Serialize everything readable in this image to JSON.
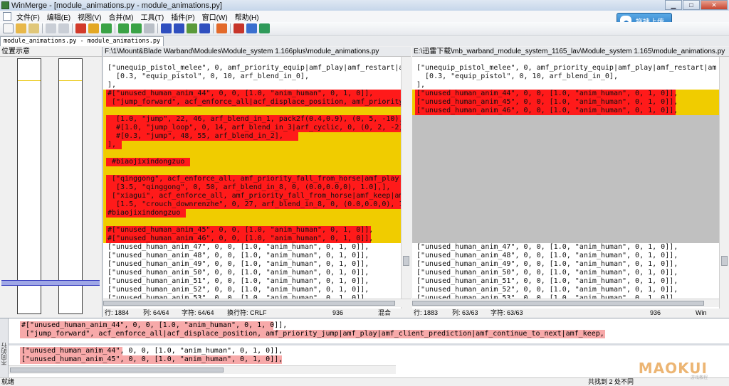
{
  "window": {
    "title": "WinMerge - [module_animations.py - module_animations.py]"
  },
  "menu": [
    "文件(F)",
    "编辑(E)",
    "视图(V)",
    "合并(M)",
    "工具(T)",
    "插件(P)",
    "窗口(W)",
    "帮助(H)"
  ],
  "upload_button": {
    "label": "拖拽上传"
  },
  "tab": {
    "label": "module_animations.py - module_animations.py"
  },
  "location_pane": {
    "header": "位置示意"
  },
  "left": {
    "path": "F:\\1\\Mount&Blade Warband\\Modules\\Module_system 1.166plus\\module_animations.py",
    "lines": [
      {
        "text": "[\"unequip_pistol_melee\", 0, amf_priority_equip|amf_play|amf_restart|am",
        "style": "plain"
      },
      {
        "text": "  [0.3, \"equip_pistol\", 0, 10, arf_blend_in_0],",
        "style": "plain"
      },
      {
        "text": "],",
        "style": "plain"
      },
      {
        "text": "#[\"unused_human_anim_44\", 0, 0, [1.0, \"anim_human\", 0, 1, 0]],",
        "style": "diff",
        "red": true,
        "red_width": 426
      },
      {
        "text": " [\"jump_forward\", acf_enforce_all|acf_displace_position, amf_priority_",
        "style": "diff",
        "red": true,
        "red_width": 426
      },
      {
        "text": "",
        "style": "diff"
      },
      {
        "text": "  [1.0, \"jump\", 22, 46, arf_blend_in_1, pack2f(0.4,0.9), (0, 5, -10),",
        "style": "diff",
        "red": true,
        "red_width": 426
      },
      {
        "text": "  #[1.0, \"jump_loop\", 0, 14, arf_blend_in_3|arf_cyclic, 0, (0, 2, -2),",
        "style": "diff",
        "red": true,
        "red_width": 426
      },
      {
        "text": "  #[0.3, \"jump\", 48, 55, arf_blend_in_2],",
        "style": "diff",
        "red": true,
        "red_width": 270
      },
      {
        "text": "],",
        "style": "diff",
        "red": true,
        "red_width": 22
      },
      {
        "text": "",
        "style": "diff"
      },
      {
        "text": " #biaojixindongzuo",
        "style": "diff",
        "red": true,
        "red_width": 118
      },
      {
        "text": "",
        "style": "diff"
      },
      {
        "text": " [\"qinggong\", acf_enforce_all, amf_priority_fall_from_horse|amf_play|a",
        "style": "diff",
        "red": true,
        "red_width": 426
      },
      {
        "text": "  [3.5, \"qinggong\", 0, 50, arf_blend_in_8, 0, (0.0,0.0,0), 1.0],],",
        "style": "diff",
        "red": true,
        "red_width": 426
      },
      {
        "text": " [\"xiagui\", acf_enforce_all, amf_priority_fall_from_horse|amf_keep|am",
        "style": "diff",
        "red": true,
        "red_width": 426
      },
      {
        "text": "  [1.5, \"crouch_downrenzhe\", 0, 27, arf_blend_in_8, 0, (0.0,0.0,0), 1",
        "style": "diff",
        "red": true,
        "red_width": 426
      },
      {
        "text": "#biaojixindongzuo",
        "style": "diff",
        "red": true,
        "red_width": 112
      },
      {
        "text": "",
        "style": "diff"
      },
      {
        "text": "#[\"unused_human_anim_45\", 0, 0, [1.0, \"anim_human\", 0, 1, 0]],",
        "style": "diff",
        "red": true,
        "red_width": 372
      },
      {
        "text": "#[\"unused_human_anim_46\", 0, 0, [1.0, \"anim_human\", 0, 1, 0]],",
        "style": "diff",
        "red": true,
        "red_width": 372
      },
      {
        "text": "[\"unused_human_anim_47\", 0, 0, [1.0, \"anim_human\", 0, 1, 0]],",
        "style": "plain"
      },
      {
        "text": "[\"unused_human_anim_48\", 0, 0, [1.0, \"anim_human\", 0, 1, 0]],",
        "style": "plain"
      },
      {
        "text": "[\"unused_human_anim_49\", 0, 0, [1.0, \"anim_human\", 0, 1, 0]],",
        "style": "plain"
      },
      {
        "text": "[\"unused_human_anim_50\", 0, 0, [1.0, \"anim_human\", 0, 1, 0]],",
        "style": "plain"
      },
      {
        "text": "[\"unused_human_anim_51\", 0, 0, [1.0, \"anim_human\", 0, 1, 0]],",
        "style": "plain"
      },
      {
        "text": "[\"unused_human_anim_52\", 0, 0, [1.0, \"anim_human\", 0, 1, 0]],",
        "style": "plain"
      },
      {
        "text": "[\"unused_human_anim_53\", 0, 0, [1.0, \"anim_human\", 0, 1, 0]],",
        "style": "plain"
      }
    ],
    "status": {
      "row": "行: 1884",
      "col": "列: 64/64",
      "chars": "字符: 64/64",
      "eol": "换行符: CRLF",
      "codepage": "936",
      "mode": "混合"
    }
  },
  "right": {
    "path": "E:\\迅雷下载\\mb_warband_module_system_1165_lav\\Module_system 1.165\\module_animations.py",
    "lines": [
      {
        "text": "[\"unequip_pistol_melee\", 0, amf_priority_equip|amf_play|amf_restart|am",
        "style": "plain"
      },
      {
        "text": "  [0.3, \"equip_pistol\", 0, 10, arf_blend_in_0],",
        "style": "plain"
      },
      {
        "text": "],",
        "style": "plain"
      },
      {
        "text": "[\"unused_human_anim_44\", 0, 0, [1.0, \"anim_human\", 0, 1, 0]],",
        "style": "diff",
        "red": true,
        "red_width": 366
      },
      {
        "text": "[\"unused_human_anim_45\", 0, 0, [1.0, \"anim_human\", 0, 1, 0]],",
        "style": "diff",
        "red": true,
        "red_width": 366
      },
      {
        "text": "[\"unused_human_anim_46\", 0, 0, [1.0, \"anim_human\", 0, 1, 0]],",
        "style": "diff",
        "red": true,
        "red_width": 366
      },
      {
        "text": "[\"unused_human_anim_47\", 0, 0, [1.0, \"anim_human\", 0, 1, 0]],",
        "style": "plain"
      },
      {
        "text": "[\"unused_human_anim_48\", 0, 0, [1.0, \"anim_human\", 0, 1, 0]],",
        "style": "plain"
      },
      {
        "text": "[\"unused_human_anim_49\", 0, 0, [1.0, \"anim_human\", 0, 1, 0]],",
        "style": "plain"
      },
      {
        "text": "[\"unused_human_anim_50\", 0, 0, [1.0, \"anim_human\", 0, 1, 0]],",
        "style": "plain"
      },
      {
        "text": "[\"unused_human_anim_51\", 0, 0, [1.0, \"anim_human\", 0, 1, 0]],",
        "style": "plain"
      },
      {
        "text": "[\"unused_human_anim_52\", 0, 0, [1.0, \"anim_human\", 0, 1, 0]],",
        "style": "plain"
      },
      {
        "text": "[\"unused_human_anim_53\", 0, 0, [1.0, \"anim_human\", 0, 1, 0]],",
        "style": "plain"
      }
    ],
    "status": {
      "row": "行: 1883",
      "col": "列: 63/63",
      "chars": "字符: 63/63",
      "codepage": "936",
      "mode": "Win"
    }
  },
  "detail": {
    "label": "不同的行",
    "top_lines": [
      "#[\"unused_human_anim_44\", 0, 0, [1.0, \"anim_human\", 0, 1, 0]],",
      " [\"jump_forward\", acf_enforce_all|acf_displace_position, amf_priority_jump|amf_play|amf_client_prediction|amf_continue_to_next|amf_keep,"
    ],
    "bottom_lines": [
      "[\"unused_human_anim_44\", 0, 0, [1.0, \"anim_human\", 0, 1, 0]],",
      "[\"unused_human_anim_45\", 0, 0, [1.0, \"anim_human\", 0, 1, 0]],"
    ]
  },
  "statusbar": {
    "ready": "就绪",
    "diffs": "共找到 2 处不同"
  },
  "watermark": {
    "main": "MAOKUI",
    "sub": "游戏教程"
  },
  "colors": {
    "diff_band": "#f0cc00",
    "diff_red": "#ff1a1a",
    "moved_gray": "#c0c0c0",
    "detail_pink": "#f7a9a9"
  }
}
